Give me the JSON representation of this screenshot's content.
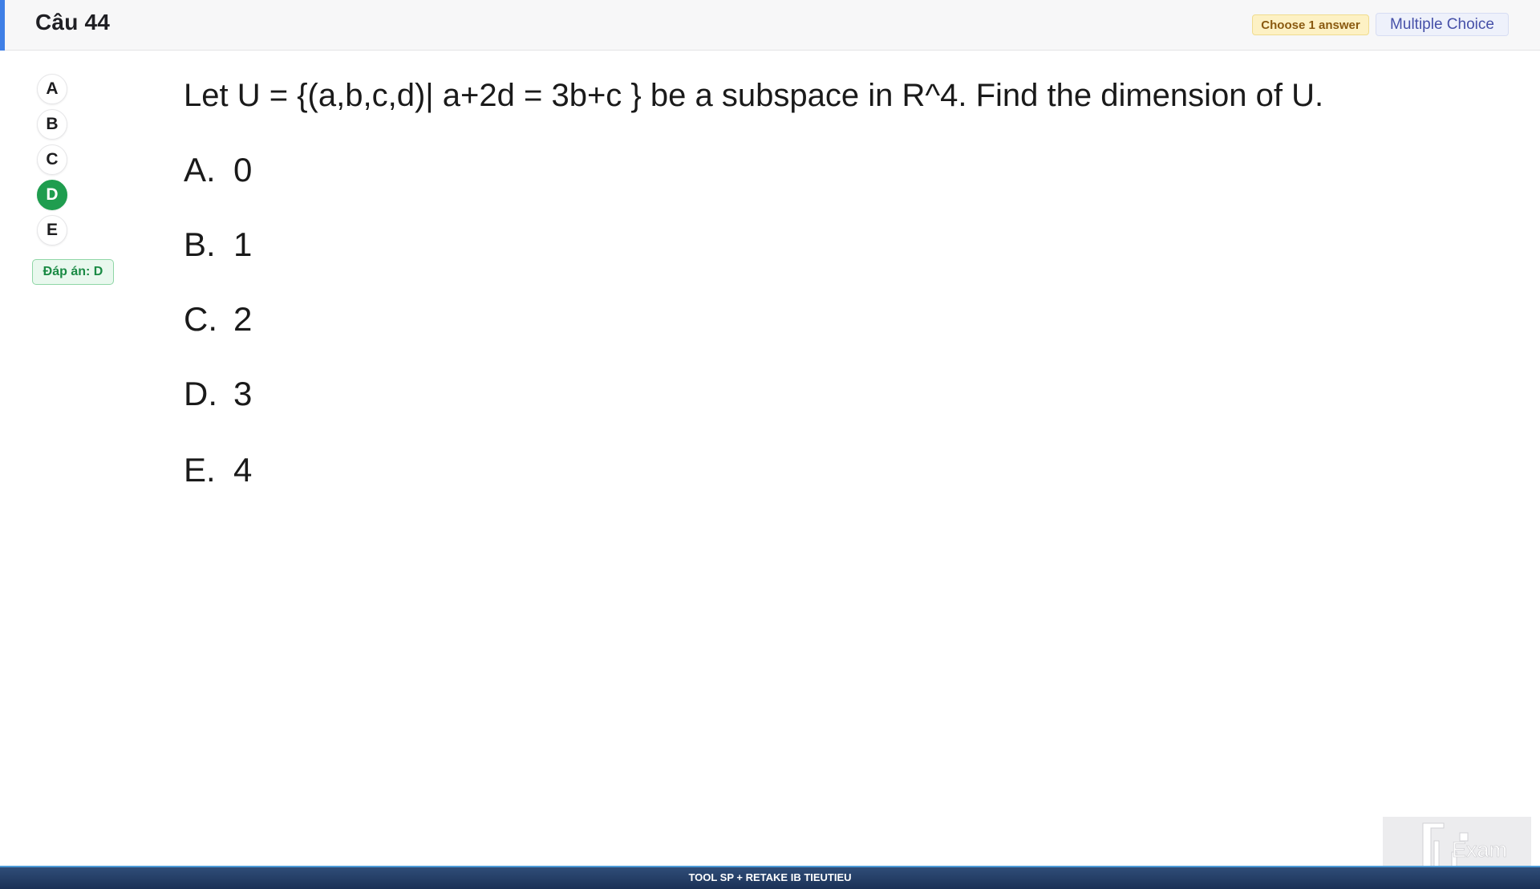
{
  "header": {
    "title": "Câu 44",
    "choose_badge": "Choose 1 answer",
    "type_badge": "Multiple Choice"
  },
  "sidebar": {
    "options": [
      {
        "label": "A",
        "selected": false
      },
      {
        "label": "B",
        "selected": false
      },
      {
        "label": "C",
        "selected": false
      },
      {
        "label": "D",
        "selected": true
      },
      {
        "label": "E",
        "selected": false
      }
    ],
    "answer_tag": "Đáp án: D"
  },
  "question": {
    "text": "Let U = {(a,b,c,d)|  a+2d = 3b+c } be a subspace in R^4. Find the dimension of U.",
    "choices": [
      {
        "letter": "A.",
        "value": "0"
      },
      {
        "letter": "B.",
        "value": "1"
      },
      {
        "letter": "C.",
        "value": "2"
      },
      {
        "letter": "D.",
        "value": "3"
      },
      {
        "letter": "E.",
        "value": "4"
      }
    ]
  },
  "logo": {
    "text": "Exam"
  },
  "footer": {
    "text": "TOOL SP + RETAKE IB TIEUTIEU"
  },
  "colors": {
    "accent": "#3f7fe6",
    "selected": "#1f9d4f",
    "footer": "#1b3156"
  }
}
